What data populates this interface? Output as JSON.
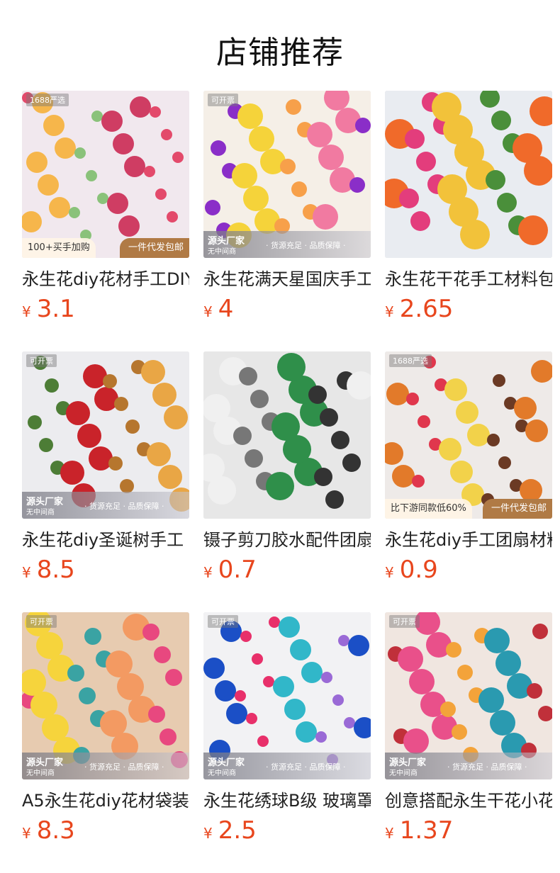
{
  "page_title": "店铺推荐",
  "currency": "¥",
  "products": [
    {
      "name": "永生花diy花材手工DIY",
      "price": "3.1",
      "top_tag": "1688严选",
      "badge_left": "100+买手加购",
      "badge_right": "一件代发包邮",
      "strip": null,
      "palette": [
        "#f1e8ee",
        "#e34a6b",
        "#f6b64b",
        "#8ac27a",
        "#cf3d63"
      ]
    },
    {
      "name": "永生花满天星国庆手工",
      "price": "4",
      "top_tag": "可开票",
      "badge_left": null,
      "badge_right": null,
      "strip": {
        "src": "源头厂家",
        "src2": "无中间商",
        "feat": "· 货源充足 · 品质保障 ·"
      },
      "palette": [
        "#f5efe7",
        "#8a2ec8",
        "#f5d33a",
        "#f7a04a",
        "#f17aa1"
      ]
    },
    {
      "name": "永生花干花手工材料包",
      "price": "2.65",
      "top_tag": null,
      "badge_left": null,
      "badge_right": null,
      "strip": null,
      "palette": [
        "#e9ecf1",
        "#e33d7c",
        "#f2c23a",
        "#4a8f3a",
        "#f06a2a"
      ]
    },
    {
      "name": "永生花diy圣诞树手工",
      "price": "8.5",
      "top_tag": "可开票",
      "badge_left": null,
      "badge_right": null,
      "strip": {
        "src": "源头厂家",
        "src2": "无中间商",
        "feat": "· 货源充足 · 品质保障 ·"
      },
      "palette": [
        "#ececef",
        "#c9232a",
        "#b6762e",
        "#e9a645",
        "#4d7d36"
      ]
    },
    {
      "name": "镊子剪刀胶水配件团扇",
      "price": "0.7",
      "top_tag": null,
      "badge_left": null,
      "badge_right": null,
      "strip": null,
      "palette": [
        "#e7e7e7",
        "#2f8f4a",
        "#333333",
        "#f0f0f0",
        "#777777"
      ]
    },
    {
      "name": "永生花diy手工团扇材料",
      "price": "0.9",
      "top_tag": "1688严选",
      "badge_left": "比下游同款低60%",
      "badge_right": "一件代发包邮",
      "strip": null,
      "palette": [
        "#eeeae8",
        "#6b3a24",
        "#e27a2a",
        "#e0374d",
        "#f2d24a"
      ]
    },
    {
      "name": "A5永生花diy花材袋装",
      "price": "8.3",
      "top_tag": "可开票",
      "badge_left": null,
      "badge_right": null,
      "strip": {
        "src": "源头厂家",
        "src2": "无中间商",
        "feat": "· 货源充足 · 品质保障 ·"
      },
      "palette": [
        "#e7cbb0",
        "#e8487f",
        "#f6d43c",
        "#3aa3a3",
        "#f39a62"
      ]
    },
    {
      "name": "永生花绣球B级 玻璃罩",
      "price": "2.5",
      "top_tag": "可开票",
      "badge_left": null,
      "badge_right": null,
      "strip": {
        "src": "源头厂家",
        "src2": "无中间商",
        "feat": "· 货源充足 · 品质保障 ·"
      },
      "palette": [
        "#f2f2f4",
        "#1b4fc6",
        "#e8306a",
        "#31b7c9",
        "#9a6ad6"
      ]
    },
    {
      "name": "创意搭配永生干花小花束",
      "price": "1.37",
      "top_tag": "可开票",
      "badge_left": null,
      "badge_right": null,
      "strip": {
        "src": "源头厂家",
        "src2": "无中间商",
        "feat": "· 货源充足 · 品质保障 ·"
      },
      "palette": [
        "#f0e6e0",
        "#e9508a",
        "#f3a33a",
        "#2a9ab0",
        "#c0303a"
      ]
    }
  ]
}
